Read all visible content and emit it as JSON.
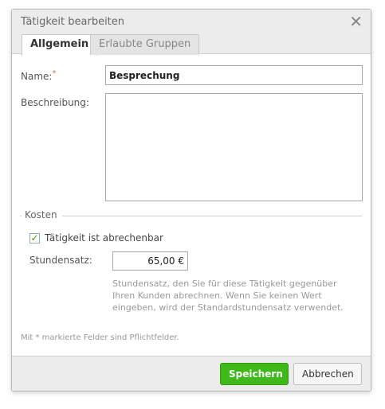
{
  "dialog": {
    "title": "Tätigkeit bearbeiten",
    "close_icon": "close-icon"
  },
  "tabs": [
    {
      "label": "Allgemein",
      "active": true
    },
    {
      "label": "Erlaubte Gruppen",
      "active": false
    }
  ],
  "form": {
    "name_label": "Name:",
    "required_marker": "*",
    "name_value": "Besprechung",
    "description_label": "Beschreibung:",
    "description_value": ""
  },
  "costs": {
    "legend": "Kosten",
    "billable_label": "Tätigkeit ist abrechenbar",
    "billable_checked": true,
    "checkmark": "✓",
    "rate_label": "Stundensatz:",
    "rate_value": "65,00 €",
    "help_text": "Stundensatz, den Sie für diese Tätigkeit gegenüber Ihren Kunden abrechnen. Wenn Sie keinen Wert eingeben, wird der Standardstundensatz verwendet."
  },
  "footnote": "Mit * markierte Felder sind Pflichtfelder.",
  "buttons": {
    "save": "Speichern",
    "cancel": "Abbrechen"
  },
  "colors": {
    "save_button": "#3fb91a",
    "header_bg": "#ececec"
  }
}
